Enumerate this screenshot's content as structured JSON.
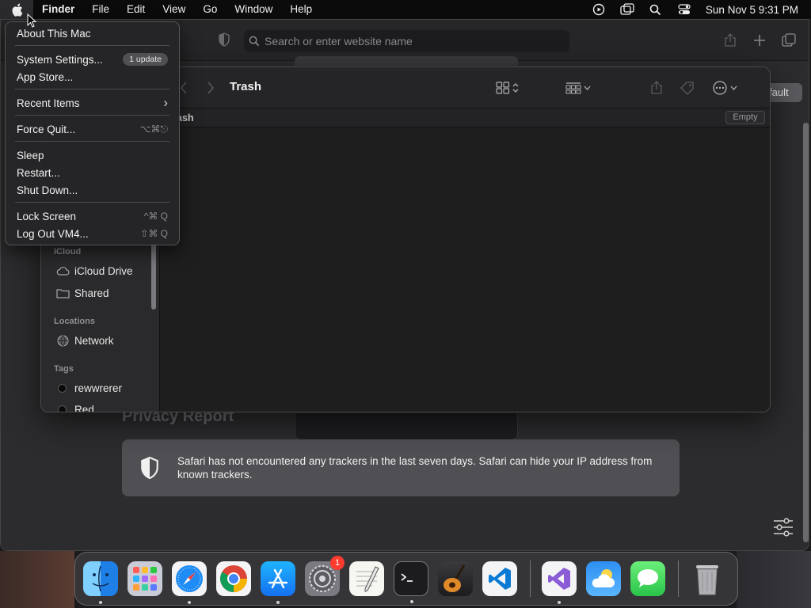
{
  "menubar": {
    "apple_icon": "apple-logo-icon",
    "items": [
      "Finder",
      "File",
      "Edit",
      "View",
      "Go",
      "Window",
      "Help"
    ],
    "status_icons": [
      "screen-record-icon",
      "screen-mirror-icon",
      "spotlight-search-icon",
      "control-center-icon"
    ],
    "clock": "Sun Nov 5  9:31 PM"
  },
  "apple_menu": {
    "about": "About This Mac",
    "system_settings": "System Settings...",
    "update_badge": "1 update",
    "app_store": "App Store...",
    "recent_items": "Recent Items",
    "recent_arrow": "›",
    "force_quit": "Force Quit...",
    "force_quit_shortcut": "⌥⌘⎋",
    "sleep": "Sleep",
    "restart": "Restart...",
    "shut_down": "Shut Down...",
    "lock_screen": "Lock Screen",
    "lock_shortcut": "^⌘ Q",
    "log_out": "Log Out VM4...",
    "log_out_shortcut": "⇧⌘ Q"
  },
  "safari": {
    "search_placeholder": "Search or enter website name",
    "default_button": "fault",
    "privacy_title": "Privacy Report",
    "privacy_text": "Safari has not encountered any trackers in the last seven days. Safari can hide your IP address from known trackers."
  },
  "finder": {
    "title": "Trash",
    "path": "ash",
    "empty_button": "Empty",
    "sidebar": {
      "icloud_header": "iCloud",
      "icloud_drive": "iCloud Drive",
      "shared": "Shared",
      "locations_header": "Locations",
      "network": "Network",
      "tags_header": "Tags",
      "tag1": "rewwrerer",
      "tag2": "Red"
    }
  },
  "dock": {
    "apps": [
      "Finder",
      "Launchpad",
      "Safari",
      "Google Chrome",
      "App Store",
      "System Settings",
      "TextEdit",
      "Terminal",
      "GarageBand",
      "Visual Studio Code",
      "Visual Studio",
      "Weather",
      "Messages"
    ],
    "system_settings_badge": "1",
    "trash": "Trash"
  },
  "colors": {
    "menu_bg": "#262628",
    "finder_bg": "#1e1e1e",
    "accent_badge": "#ff3b30"
  }
}
